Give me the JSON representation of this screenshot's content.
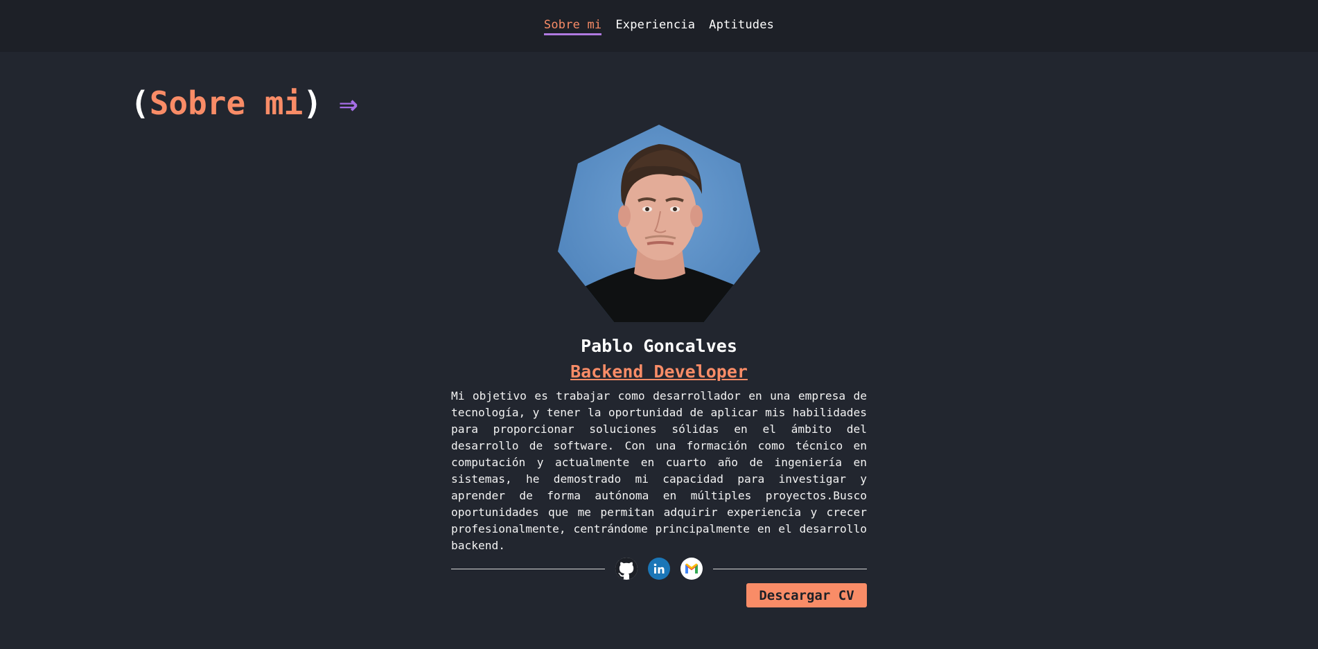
{
  "nav": {
    "items": [
      {
        "label": "Sobre mi",
        "active": true
      },
      {
        "label": "Experiencia",
        "active": false
      },
      {
        "label": "Aptitudes",
        "active": false
      }
    ]
  },
  "section": {
    "open_paren": "(",
    "title": "Sobre mi",
    "close_paren": ")",
    "arrow": "⇒"
  },
  "profile": {
    "name": "Pablo Goncalves",
    "role": "Backend Developer",
    "bio": "Mi objetivo es trabajar como desarrollador en una empresa de tecnología, y tener la oportunidad de aplicar mis habilidades para proporcionar soluciones sólidas en el ámbito del desarrollo de software. Con una formación como técnico en computación y actualmente en cuarto año de ingeniería en sistemas, he demostrado mi capacidad para investigar y aprender de forma autónoma en múltiples proyectos.Busco oportunidades que me permitan adquirir experiencia y crecer profesionalmente, centrándome principalmente en el desarrollo backend."
  },
  "social": {
    "icons": [
      "github-icon",
      "linkedin-icon",
      "gmail-icon"
    ]
  },
  "cta": {
    "download_label": "Descargar CV"
  },
  "colors": {
    "background": "#22262f",
    "nav_background": "#1d2027",
    "accent": "#f98c67",
    "purple": "#a56ee6",
    "linkedin": "#1b76b7"
  }
}
